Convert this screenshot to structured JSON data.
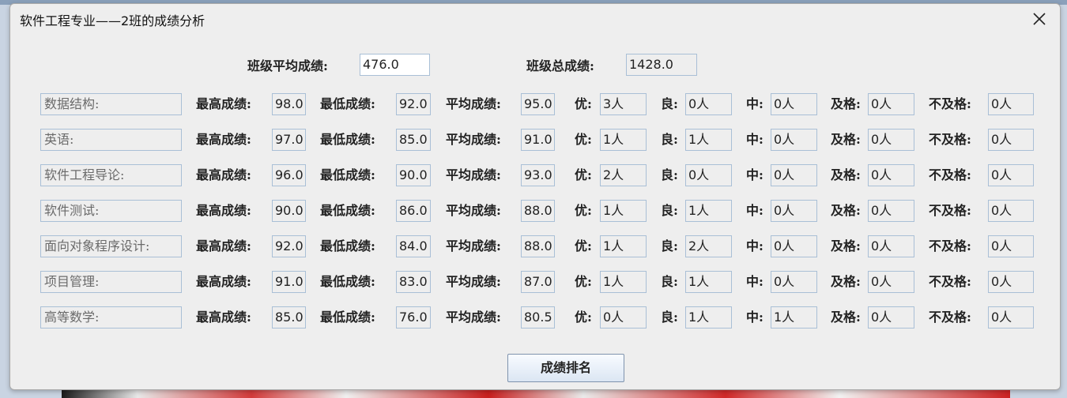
{
  "window": {
    "title": "软件工程专业——2班的成绩分析"
  },
  "summary": {
    "avg_label": "班级平均成绩:",
    "avg_value": "476.0",
    "total_label": "班级总成绩:",
    "total_value": "1428.0"
  },
  "labels": {
    "max": "最高成绩:",
    "min": "最低成绩:",
    "avg": "平均成绩:",
    "excellent": "优:",
    "good": "良:",
    "medium": "中:",
    "pass": "及格:",
    "fail": "不及格:"
  },
  "courses": [
    {
      "name": "数据结构:",
      "max": "98.0",
      "min": "92.0",
      "avg": "95.0",
      "excellent": "3人",
      "good": "0人",
      "medium": "0人",
      "pass": "0人",
      "fail": "0人"
    },
    {
      "name": "英语:",
      "max": "97.0",
      "min": "85.0",
      "avg": "91.0",
      "excellent": "1人",
      "good": "1人",
      "medium": "0人",
      "pass": "0人",
      "fail": "0人"
    },
    {
      "name": "软件工程导论:",
      "max": "96.0",
      "min": "90.0",
      "avg": "93.0",
      "excellent": "2人",
      "good": "0人",
      "medium": "0人",
      "pass": "0人",
      "fail": "0人"
    },
    {
      "name": "软件测试:",
      "max": "90.0",
      "min": "86.0",
      "avg": "88.0",
      "excellent": "1人",
      "good": "1人",
      "medium": "0人",
      "pass": "0人",
      "fail": "0人"
    },
    {
      "name": "面向对象程序设计:",
      "max": "92.0",
      "min": "84.0",
      "avg": "88.0",
      "excellent": "1人",
      "good": "2人",
      "medium": "0人",
      "pass": "0人",
      "fail": "0人"
    },
    {
      "name": "项目管理:",
      "max": "91.0",
      "min": "83.0",
      "avg": "87.0",
      "excellent": "1人",
      "good": "1人",
      "medium": "0人",
      "pass": "0人",
      "fail": "0人"
    },
    {
      "name": "高等数学:",
      "max": "85.0",
      "min": "76.0",
      "avg": "80.5",
      "excellent": "0人",
      "good": "1人",
      "medium": "1人",
      "pass": "0人",
      "fail": "0人"
    }
  ],
  "buttons": {
    "rank": "成绩排名"
  },
  "icons": {
    "close": "close-icon"
  },
  "colors": {
    "field_border": "#a9bfd6",
    "window_bg": "#eeeeee"
  }
}
